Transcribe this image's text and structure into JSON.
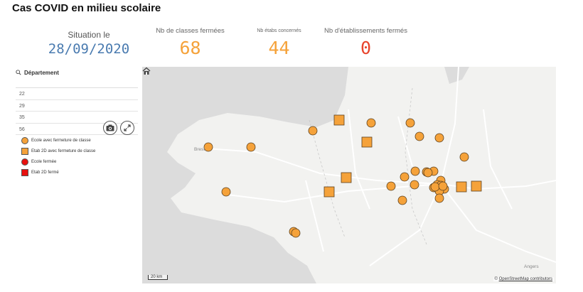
{
  "page": {
    "title": "Cas COVID en milieu scolaire"
  },
  "kpis": {
    "date": {
      "label": "Situation le",
      "value": "28/09/2020"
    },
    "classes": {
      "label": "Nb de classes fermées",
      "value": "68"
    },
    "etabs": {
      "label": "Nb étabs concernés",
      "value": "44"
    },
    "closed": {
      "label": "Nb d'établissements fermés",
      "value": "0"
    }
  },
  "filter": {
    "title": "Département",
    "items": [
      "22",
      "29",
      "35",
      "56"
    ]
  },
  "tools": {
    "camera_icon": "camera-icon",
    "expand_icon": "expand-icon"
  },
  "legend": {
    "items": [
      {
        "label": "Ecole avec fermeture de classe",
        "shape": "circle",
        "color": "#f5a23a"
      },
      {
        "label": "Etab 2D avec fermeture de classe",
        "shape": "square",
        "color": "#f5a23a"
      },
      {
        "label": "Ecole fermée",
        "shape": "circle",
        "color": "#e8110f"
      },
      {
        "label": "Etab 2D fermé",
        "shape": "square",
        "color": "#e8110f"
      }
    ]
  },
  "map": {
    "labels": {
      "brest": "Brest",
      "angers": "Angers"
    },
    "scale": "20 km",
    "attribution": {
      "prefix": "©",
      "link": "OpenStreetMap contributors"
    },
    "home_icon": "home-icon"
  },
  "colors": {
    "orange": "#f5a23a",
    "red": "#e8110f",
    "date_blue": "#4a7bb0",
    "kpi_red": "#e8442c"
  }
}
